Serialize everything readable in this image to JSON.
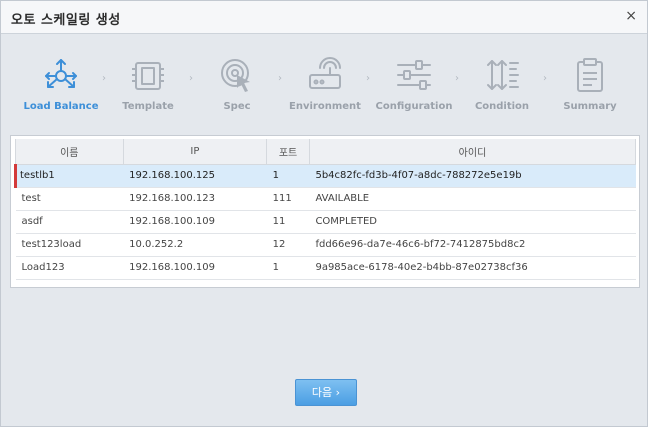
{
  "window": {
    "title": "오토 스케일링 생성",
    "close_glyph": "×"
  },
  "steps": [
    {
      "label": "Load Balance",
      "icon": "load-balance-icon",
      "active": true
    },
    {
      "label": "Template",
      "icon": "template-icon",
      "active": false
    },
    {
      "label": "Spec",
      "icon": "spec-icon",
      "active": false
    },
    {
      "label": "Environment",
      "icon": "environment-icon",
      "active": false
    },
    {
      "label": "Configuration",
      "icon": "configuration-icon",
      "active": false
    },
    {
      "label": "Condition",
      "icon": "condition-icon",
      "active": false
    },
    {
      "label": "Summary",
      "icon": "summary-icon",
      "active": false
    }
  ],
  "step_arrow": "›",
  "colors": {
    "accent": "#3d8fd8",
    "inactive": "#9aa1aa",
    "selected_row": "#d9ebfa",
    "selection_marker": "#d33a3a"
  },
  "table": {
    "headers": [
      "이름",
      "IP",
      "포트",
      "아이디"
    ],
    "rows": [
      {
        "name": "testlb1",
        "ip": "192.168.100.125",
        "port": "1",
        "id": "5b4c82fc-fd3b-4f07-a8dc-788272e5e19b",
        "selected": true
      },
      {
        "name": "test",
        "ip": "192.168.100.123",
        "port": "111",
        "id": "AVAILABLE",
        "selected": false
      },
      {
        "name": "asdf",
        "ip": "192.168.100.109",
        "port": "11",
        "id": "COMPLETED",
        "selected": false
      },
      {
        "name": "test123load",
        "ip": "10.0.252.2",
        "port": "12",
        "id": "fdd66e96-da7e-46c6-bf72-7412875bd8c2",
        "selected": false
      },
      {
        "name": "Load123",
        "ip": "192.168.100.109",
        "port": "1",
        "id": "9a985ace-6178-40e2-b4bb-87e02738cf36",
        "selected": false
      }
    ]
  },
  "footer": {
    "next_label": "다음 ›"
  }
}
